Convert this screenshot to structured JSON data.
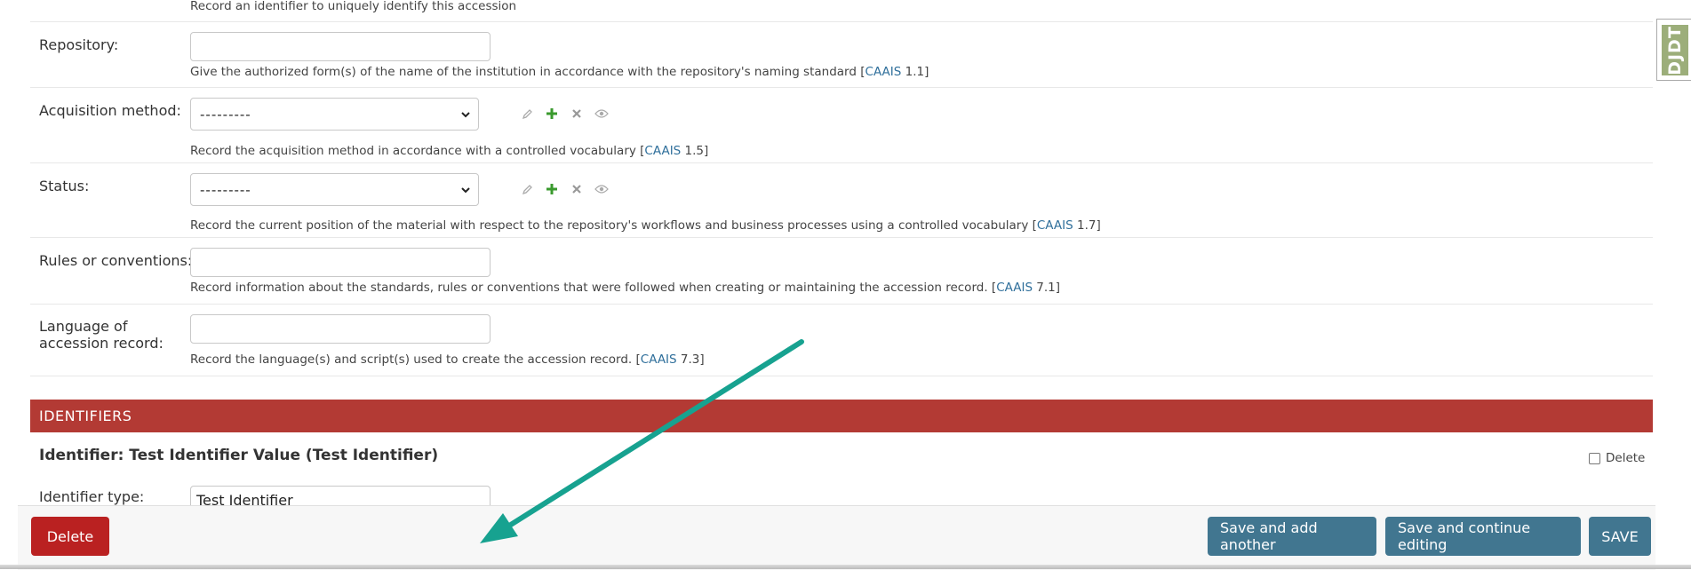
{
  "top_help": "Record an identifier to uniquely identify this accession",
  "fields": {
    "repository": {
      "label": "Repository:",
      "help_text": "Give the authorized form(s) of the name of the institution in accordance with the repository's naming standard [",
      "ref_link": "CAAIS",
      "ref_num": " 1.1]",
      "value": ""
    },
    "acquisition_method": {
      "label": "Acquisition method:",
      "selected": "---------",
      "help_text": "Record the acquisition method in accordance with a controlled vocabulary [",
      "ref_link": "CAAIS",
      "ref_num": " 1.5]"
    },
    "status": {
      "label": "Status:",
      "selected": "---------",
      "help_text": "Record the current position of the material with respect to the repository's workflows and business processes using a controlled vocabulary [",
      "ref_link": "CAAIS",
      "ref_num": " 1.7]"
    },
    "rules": {
      "label": "Rules or conventions:",
      "help_text": "Record information about the standards, rules or conventions that were followed when creating or maintaining the accession record. [",
      "ref_link": "CAAIS",
      "ref_num": " 7.1]",
      "value": ""
    },
    "language": {
      "label_line1": "Language of",
      "label_line2": "accession record:",
      "help_text": "Record the language(s) and script(s) used to create the accession record. [",
      "ref_link": "CAAIS",
      "ref_num": " 7.3]",
      "value": ""
    }
  },
  "identifiers": {
    "section_title": "IDENTIFIERS",
    "inline_title": "Identifier: Test Identifier Value (Test Identifier)",
    "delete_label": "Delete",
    "type_label": "Identifier type:",
    "type_value": "Test Identifier"
  },
  "footer": {
    "delete": "Delete",
    "save_add": "Save and add another",
    "save_continue": "Save and continue editing",
    "save": "SAVE"
  },
  "toolbar": {
    "djdt": "DJDT"
  },
  "colors": {
    "section_bar": "#b33a34",
    "button_blue": "#417690",
    "button_red": "#ba2121",
    "link": "#2f6f9b",
    "arrow": "#17a290",
    "add_icon": "#3a9a2e"
  },
  "icons": [
    "pencil-icon",
    "plus-icon",
    "close-icon",
    "eye-icon"
  ]
}
